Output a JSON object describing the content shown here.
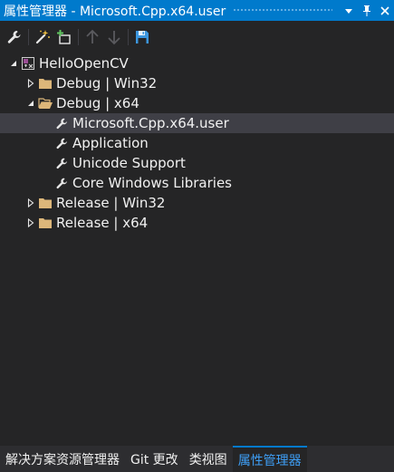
{
  "titlebar": {
    "title": "属性管理器 - Microsoft.Cpp.x64.user",
    "dropdown_glyph": "▾",
    "pin_glyph": "ᵖ",
    "close_glyph": "✕"
  },
  "tree": {
    "root": "HelloOpenCV",
    "groups": [
      {
        "label": "Debug | Win32"
      },
      {
        "label": "Debug | x64",
        "children": [
          "Microsoft.Cpp.x64.user",
          "Application",
          "Unicode Support",
          "Core Windows Libraries"
        ]
      },
      {
        "label": "Release | Win32"
      },
      {
        "label": "Release | x64"
      }
    ]
  },
  "bottom_tabs": [
    {
      "label": "解决方案资源管理器"
    },
    {
      "label": "Git 更改"
    },
    {
      "label": "类视图"
    },
    {
      "label": "属性管理器"
    }
  ],
  "colors": {
    "accent": "#007acc",
    "background": "#252526",
    "folder": "#dcb67a",
    "active_tab_text": "#3e9ef5"
  }
}
